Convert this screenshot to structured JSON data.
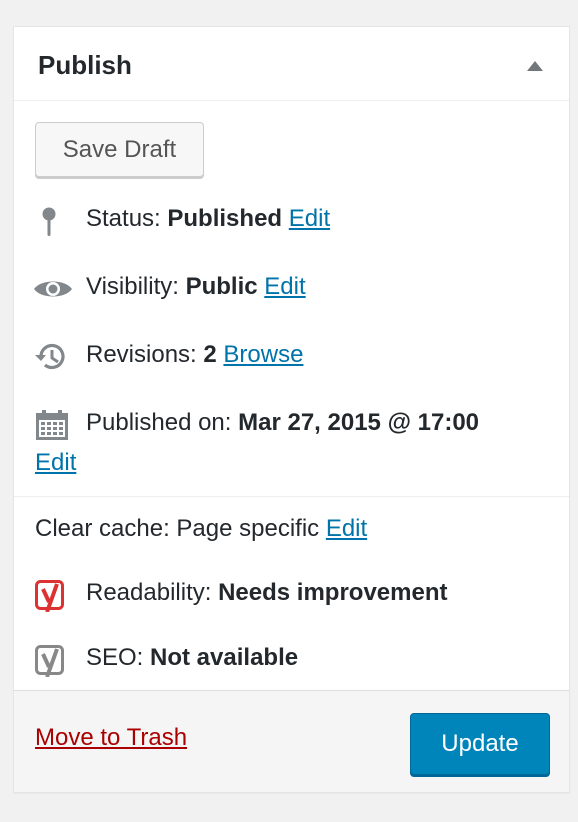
{
  "panel": {
    "title": "Publish",
    "save_draft_label": "Save Draft",
    "status": {
      "label": "Status:",
      "value": "Published",
      "edit": "Edit"
    },
    "visibility": {
      "label": "Visibility:",
      "value": "Public",
      "edit": "Edit"
    },
    "revisions": {
      "label": "Revisions:",
      "value": "2",
      "browse": "Browse"
    },
    "published_on": {
      "label": "Published on:",
      "value": "Mar 27, 2015 @ 17:00",
      "edit": "Edit"
    },
    "cache": {
      "label": "Clear cache: Page specific",
      "edit": "Edit"
    },
    "readability": {
      "label": "Readability:",
      "value": "Needs improvement"
    },
    "seo": {
      "label": "SEO:",
      "value": "Not available"
    },
    "move_to_trash": "Move to Trash",
    "update_label": "Update"
  },
  "icons": {
    "status": "pin-icon",
    "visibility": "eye-icon",
    "revisions": "history-icon",
    "published_on": "calendar-icon",
    "readability": "yoast-icon",
    "seo": "yoast-icon"
  },
  "colors": {
    "link": "#0073aa",
    "trash": "#aa0000",
    "primary_button": "#0085ba",
    "readability_icon": "#dc3232",
    "seo_icon": "#888888"
  }
}
